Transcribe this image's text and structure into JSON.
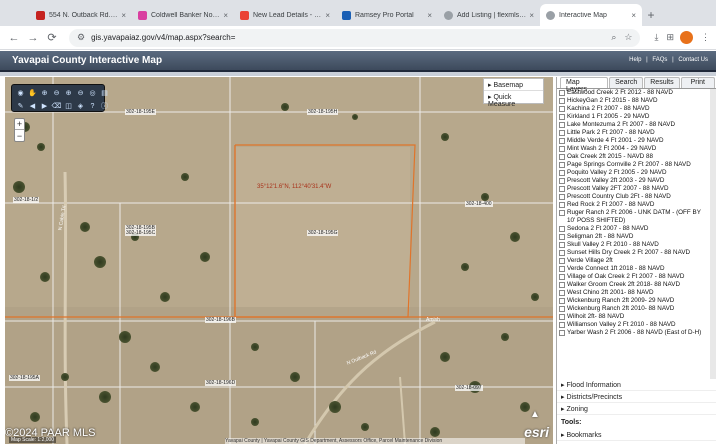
{
  "browser": {
    "tabs": [
      {
        "label": "554 N. Outback Rd.,Avery",
        "color": "#c5221f"
      },
      {
        "label": "Coldwell Banker Northland",
        "color": "#d93fa0"
      },
      {
        "label": "New Lead Details - Ray Sc",
        "color": "#ea4335"
      },
      {
        "label": "Ramsey Pro Portal",
        "color": "#1a5fb4"
      },
      {
        "label": "Add Listing | flexmls Web",
        "color": "#5f6368"
      },
      {
        "label": "Interactive Map",
        "color": "#5f6368"
      }
    ],
    "url": "gis.yavapaiaz.gov/v4/map.aspx?search="
  },
  "header": {
    "title": "Yavapai County Interactive Map",
    "links": [
      "Help",
      "|",
      "FAQs",
      "|",
      "Contact Us"
    ]
  },
  "map": {
    "basemap_label": "Basemap",
    "quick_measure_label": "Quick Measure",
    "parcel_labels": [
      "302-18-195E",
      "302-18-195H",
      "302-18-195B",
      "302-18-195C",
      "302-18-195G",
      "302-18-400",
      "302-18-195A",
      "302-18-196D",
      "302-18-196B",
      "302-18-097",
      "302-18-1/2",
      "N Cabin Trl",
      "Amish",
      "N Outback Rd"
    ],
    "coordinate": "35°12'1.6\"N, 112°40'31.4\"W",
    "attribution": "Yavapai County | Yavapai County GIS Department, Assessors Office, Parcel Maintenance Division",
    "copyright": "©2024 PAAR MLS",
    "scale": "Map Scale: 1:2,000",
    "esri": "esri"
  },
  "panel": {
    "tabs": [
      "Map Layers",
      "Search",
      "Results",
      "Print"
    ],
    "layers": [
      "Eastwood Creek 2 Ft 2012 - 88 NAVD",
      "HickeyGan 2 Ft 2015 - 88 NAVD",
      "Kachina 2 Ft 2007 - 88 NAVD",
      "Kirkland 1 Ft 2005 - 29 NAVD",
      "Lake Montezuma 2 Ft 2007 - 88 NAVD",
      "Little Park 2 Ft 2007 - 88 NAVD",
      "Middle Verde 4 Ft 2001 - 29 NAVD",
      "Mint Wash 2 Ft 2004 - 29 NAVD",
      "Oak Creek 2ft 2015 - NAVD 88",
      "Page Springs Cornville 2 Ft 2007 - 88 NAVD",
      "Poquito Valley 2 Ft 2005 - 29 NAVD",
      "Prescott Valley 2ft 2003 - 29 NAVD",
      "Prescott Valley 2FT 2007 - 88 NAVD",
      "Prescott Country Club 2Ft - 88 NAVD",
      "Red Rock 2 Ft 2007 - 88 NAVD",
      "Ruger Ranch 2 Ft 2006 - UNK DATM - (OFF BY 10' POSS SHIFTED)",
      "Sedona 2 Ft 2007 - 88 NAVD",
      "Seligman 2ft - 88 NAVD",
      "Skull Valley 2 Ft 2010 - 88 NAVD",
      "Sunset Hills Dry Creek 2 Ft 2007 - 88 NAVD",
      "Verde Village 2ft",
      "Verde Connect 1ft 2018 - 88 NAVD",
      "Village of Oak Creek 2 Ft 2007 - 88 NAVD",
      "Walker Groom Creek 2ft 2018- 88 NAVD",
      "West Chino 2ft 2001- 88 NAVD",
      "Wickenburg Ranch 2ft 2009- 29 NAVD",
      "Wickenburg Ranch 2ft 2010- 88 NAVD",
      "Wilhoit 2ft- 88 NAVD",
      "Williamson Valley 2 Ft 2010 - 88 NAVD",
      "Yarber Wash 2 Ft 2006 - 88 NAVD (East of D-H)"
    ],
    "sections": [
      "Flood Information",
      "Districts/Precincts",
      "Zoning"
    ],
    "tools_label": "Tools:",
    "bookmarks_label": "Bookmarks"
  }
}
